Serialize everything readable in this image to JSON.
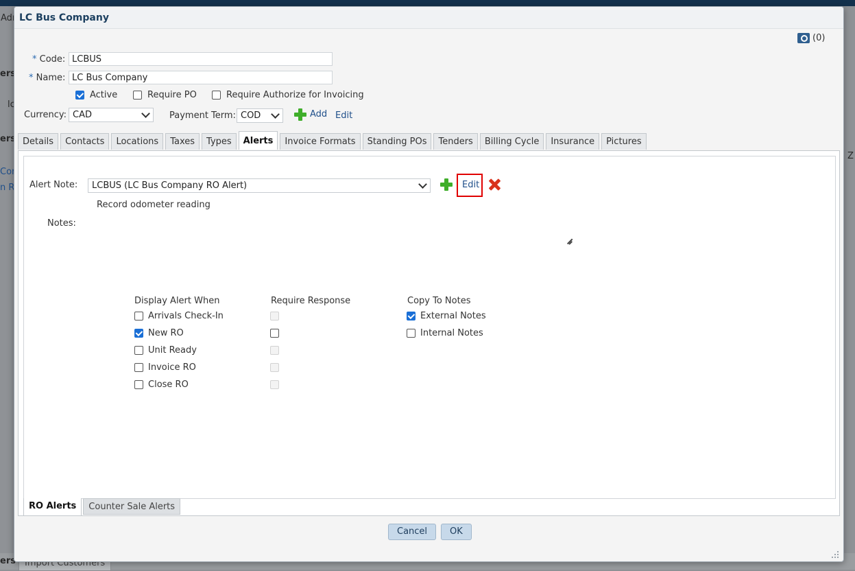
{
  "background": {
    "fragments": [
      "Adı",
      "ers",
      "lc",
      "ers",
      "Cor",
      "n Re",
      "Z",
      "ers"
    ],
    "bottom_tab": "Import Customers"
  },
  "dialog": {
    "title": "LC Bus Company",
    "attachments_count": "(0)",
    "form": {
      "code_label": "Code:",
      "code_value": "LCBUS",
      "name_label": "Name:",
      "name_value": "LC Bus Company",
      "required_marker": "*",
      "active_label": "Active",
      "active_checked": true,
      "require_po_label": "Require PO",
      "require_po_checked": false,
      "require_auth_label": "Require Authorize for Invoicing",
      "require_auth_checked": false,
      "currency_label": "Currency:",
      "currency_value": "CAD",
      "payment_term_label": "Payment Term:",
      "payment_term_value": "COD",
      "add_label": "Add",
      "edit_label": "Edit"
    },
    "tabs": [
      "Details",
      "Contacts",
      "Locations",
      "Taxes",
      "Types",
      "Alerts",
      "Invoice Formats",
      "Standing POs",
      "Tenders",
      "Billing Cycle",
      "Insurance",
      "Pictures"
    ],
    "active_tab": "Alerts",
    "alerts": {
      "alert_note_label": "Alert Note:",
      "alert_note_value": "LCBUS (LC Bus Company RO Alert)",
      "edit_label": "Edit",
      "description": "Record odometer reading",
      "notes_label": "Notes:",
      "display_alert_when": {
        "header": "Display Alert When",
        "items": [
          {
            "label": "Arrivals Check-In",
            "checked": false
          },
          {
            "label": "New RO",
            "checked": true
          },
          {
            "label": "Unit Ready",
            "checked": false
          },
          {
            "label": "Invoice RO",
            "checked": false
          },
          {
            "label": "Close RO",
            "checked": false
          }
        ]
      },
      "require_response": {
        "header": "Require Response",
        "items": [
          {
            "checked": false,
            "disabled": true
          },
          {
            "checked": false,
            "disabled": false
          },
          {
            "checked": false,
            "disabled": true
          },
          {
            "checked": false,
            "disabled": true
          },
          {
            "checked": false,
            "disabled": true
          }
        ]
      },
      "copy_to_notes": {
        "header": "Copy To Notes",
        "items": [
          {
            "label": "External Notes",
            "checked": true
          },
          {
            "label": "Internal Notes",
            "checked": false
          }
        ]
      }
    },
    "subtabs": [
      "RO Alerts",
      "Counter Sale Alerts"
    ],
    "active_subtab": "RO Alerts",
    "buttons": {
      "cancel": "Cancel",
      "ok": "OK"
    },
    "colors": {
      "accent": "#1a6fd6",
      "highlight": "#e00000",
      "add_green": "#3fae2a",
      "delete_red": "#d9321b"
    }
  }
}
